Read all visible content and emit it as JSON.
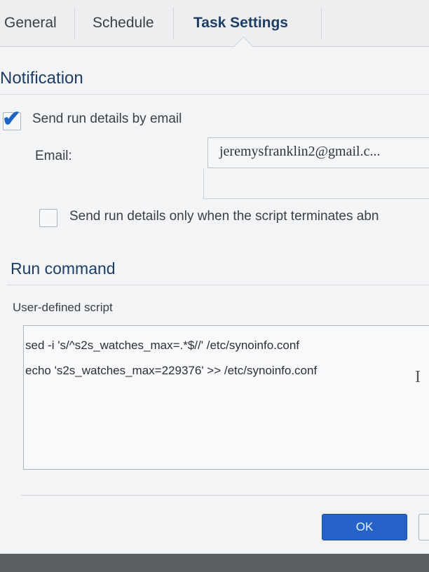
{
  "tabs": [
    {
      "label": "General"
    },
    {
      "label": "Schedule"
    },
    {
      "label": "Task Settings",
      "active": true
    }
  ],
  "notification": {
    "title": "Notification",
    "send_email_label": "Send run details by email",
    "send_email_checked": true,
    "email_label": "Email:",
    "email_value": "jeremysfranklin2@gmail.c...",
    "abnormal_label": "Send run details only when the script terminates abn",
    "abnormal_checked": false
  },
  "run_command": {
    "title": "Run command",
    "script_label": "User-defined script",
    "script_lines": [
      "sed -i 's/^s2s_watches_max=.*$//' /etc/synoinfo.conf",
      "echo 's2s_watches_max=229376' >> /etc/synoinfo.conf"
    ]
  },
  "footer": {
    "ok_label": "OK"
  },
  "icons": {
    "checkmark": "checkmark-icon",
    "text_cursor": "text-cursor-icon"
  },
  "colors": {
    "accent": "#2563c9",
    "title": "#1f3e63",
    "check": "#1f65c4"
  }
}
